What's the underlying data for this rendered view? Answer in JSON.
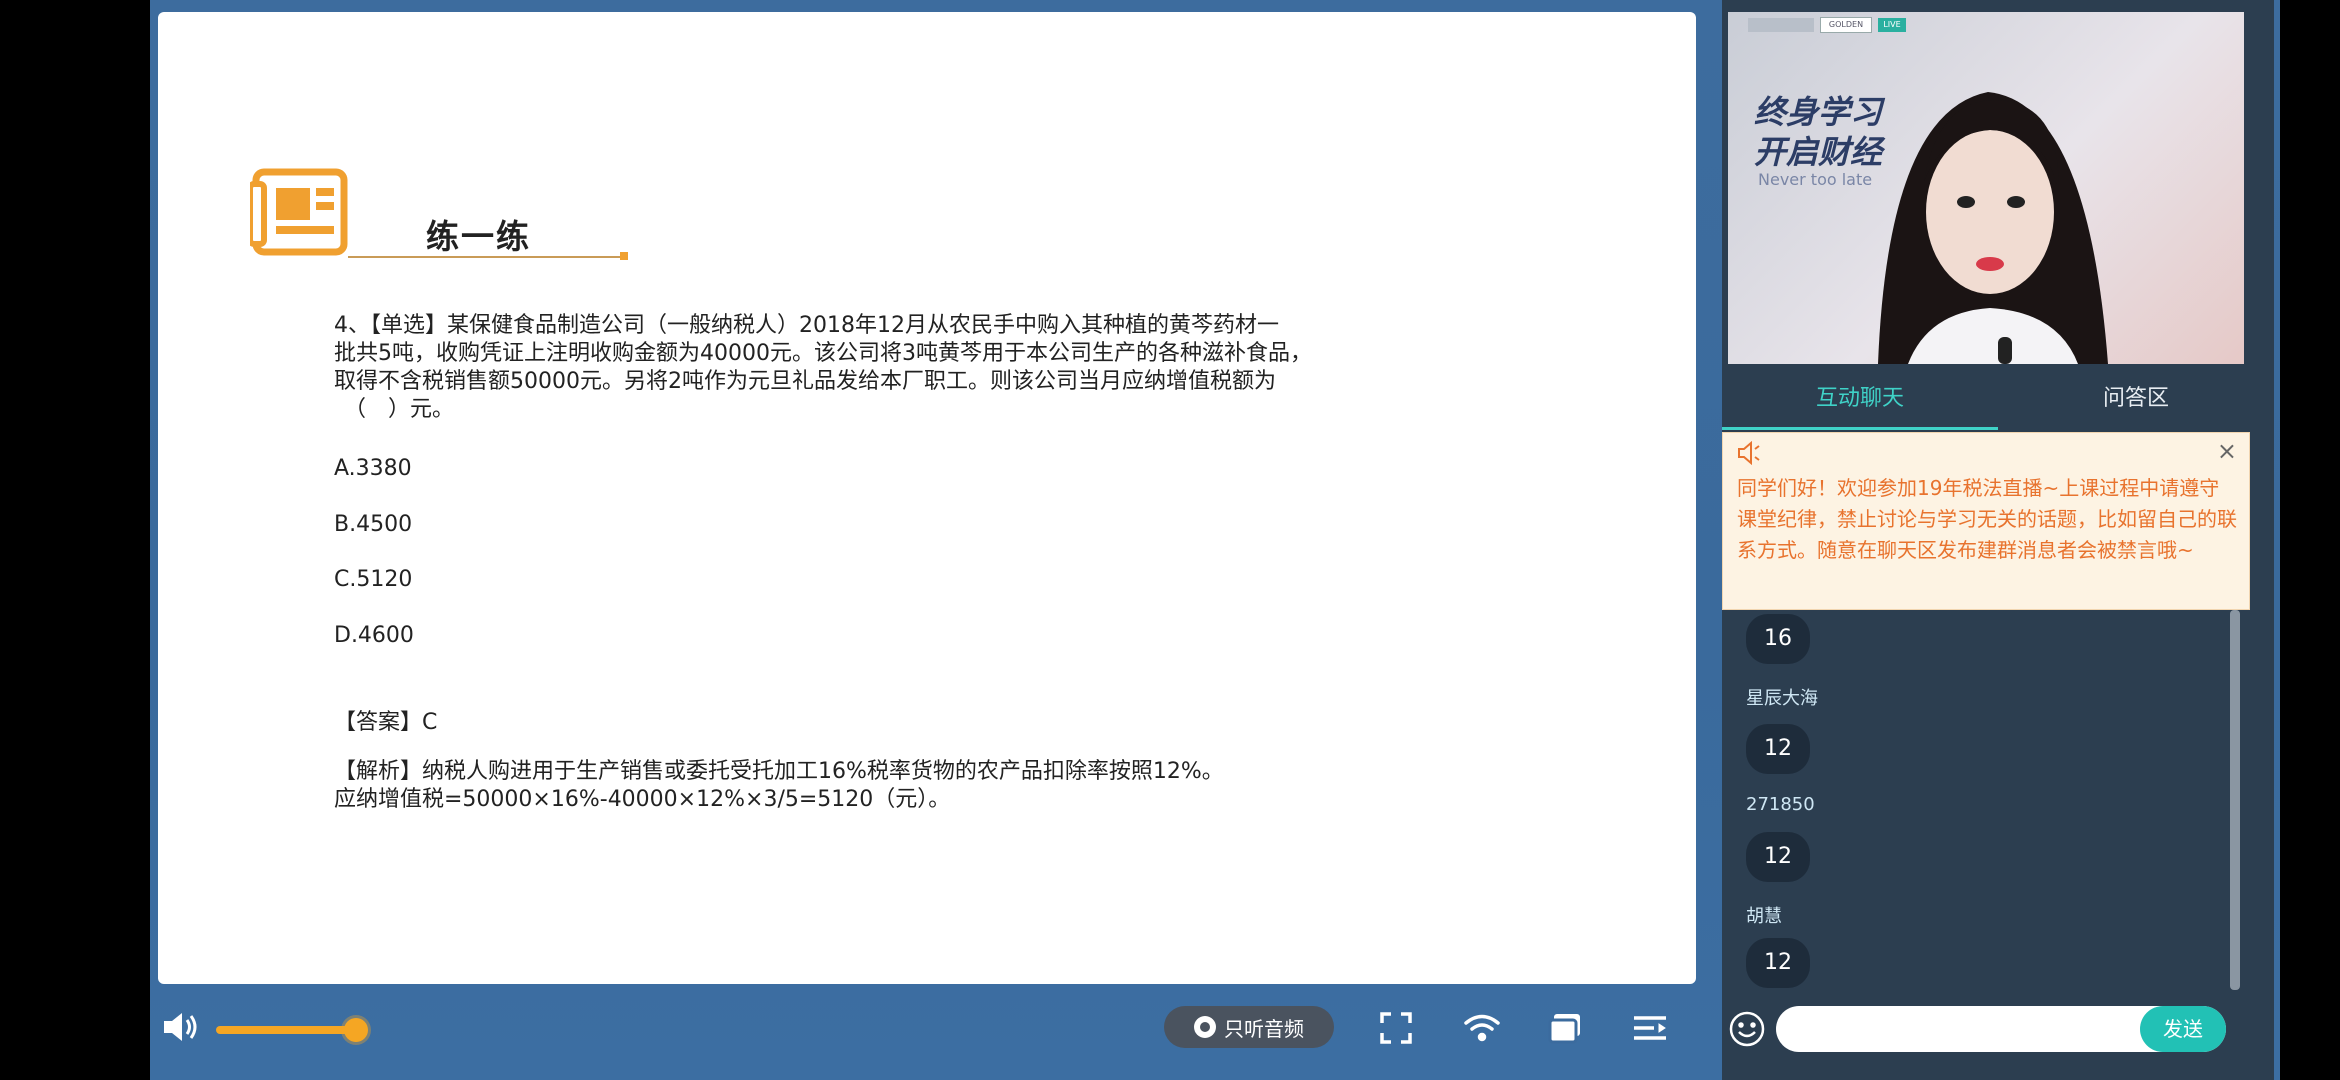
{
  "slide": {
    "section_title": "练一练",
    "question_lines": [
      "4、【单选】某保健食品制造公司（一般纳税人）2018年12月从农民手中购入其种植的黄芩药材一",
      "批共5吨，收购凭证上注明收购金额为40000元。该公司将3吨黄芩用于本公司生产的各种滋补食品，",
      "取得不含税销售额50000元。另将2吨作为元旦礼品发给本厂职工。则该公司当月应纳增值税额为",
      "（　）元。"
    ],
    "options": [
      "A.3380",
      "B.4500",
      "C.5120",
      "D.4600"
    ],
    "answer": "【答案】C",
    "analysis_lines": [
      "【解析】纳税人购进用于生产销售或委托受托加工16%税率货物的农产品扣除率按照12%。",
      "应纳增值税=50000×16%-40000×12%×3/5=5120（元）。"
    ]
  },
  "controls": {
    "volume_level": 0.7,
    "audio_only_label": "只听音频",
    "icons": [
      "volume-icon",
      "fullscreen-icon",
      "wifi-icon",
      "pip-icon",
      "playlist-icon"
    ]
  },
  "video": {
    "wall_text_line1": "终身学习",
    "wall_text_line2": "开启财经",
    "wall_sub": "Never too late",
    "brand_golden": "GOLDEN",
    "brand_live": "LIVE"
  },
  "tabs": [
    "互动聊天",
    "问答区"
  ],
  "notice": {
    "message": "同学们好！欢迎参加19年税法直播~上课过程中请遵守课堂纪律，禁止讨论与学习无关的话题，比如留自己的联系方式。随意在聊天区发布建群消息者会被禁言哦~",
    "close_symbol": "×"
  },
  "chat": [
    {
      "name": "",
      "message": "16"
    },
    {
      "name": "星辰大海",
      "message": "12"
    },
    {
      "name": "271850",
      "message": "12"
    },
    {
      "name": "胡慧",
      "message": "12"
    }
  ],
  "input": {
    "placeholder": "",
    "send_label": "发送"
  },
  "colors": {
    "accent": "#3fd2c7",
    "notice_text": "#e8732e",
    "volume": "#f5a623",
    "panel_bg": "#2c3e50"
  }
}
